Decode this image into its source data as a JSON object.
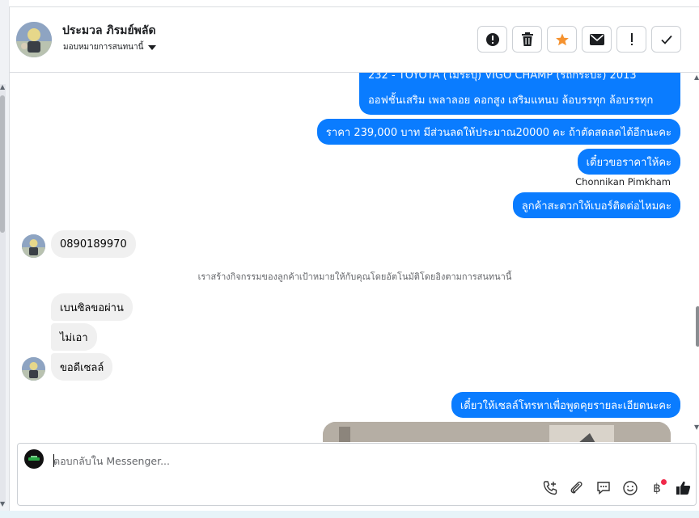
{
  "header": {
    "contact_name": "ประมวล ภิรมย์พลัด",
    "assign_label": "มอบหมายการสนทนานี้",
    "actions": [
      "alert-circle",
      "delete",
      "star",
      "mail",
      "important",
      "done"
    ]
  },
  "conversation": {
    "partial_top_text": "232 - TOYOTA (ไม่ระบุ) VIGO CHAMP (รถกระบะ) 2013",
    "outgoing_1": "ออฟชั้นเสริม เพลาลอย คอกสูง เสริมแหนบ ล้อบรรทุก ล้อบรรทุก",
    "outgoing_2": "ราคา 239,000 บาท มีส่วนลดให้ประมาณ20000 คะ ถ้าตัดสดลดได้อีกนะคะ",
    "outgoing_3": "เดี๋ยวขอราคาให้คะ",
    "sender_name": "Chonnikan Pimkham",
    "outgoing_4": "ลูกค้าสะดวกให้เบอร์ติดต่อไหมคะ",
    "incoming_phone": "0890189970",
    "system_note": "เราสร้างกิจกรรมของลูกค้าเป้าหมายให้กับคุณโดยอัตโนมัติโดยอิงตามการสนทนานี้",
    "incoming_1": "เบนซิลขอผ่าน",
    "incoming_2": "ไม่เอา",
    "incoming_3": "ขอดีเซลล์",
    "outgoing_5": "เดี๋ยวให้เซลล์โทรหาเพื่อพูดคุยรายละเอียดนะคะ"
  },
  "composer": {
    "placeholder": "ตอบกลับใน Messenger...",
    "tools": [
      "call-add-icon",
      "paperclip-icon",
      "saved-replies-icon",
      "emoji-icon",
      "baht-icon",
      "thumbs-up-icon"
    ],
    "baht_symbol": "฿"
  },
  "colors": {
    "outgoing_bubble": "#0a7cff",
    "incoming_bubble": "#f0f0f0",
    "star_accent": "#f5922f",
    "notification_dot": "#f02849"
  }
}
